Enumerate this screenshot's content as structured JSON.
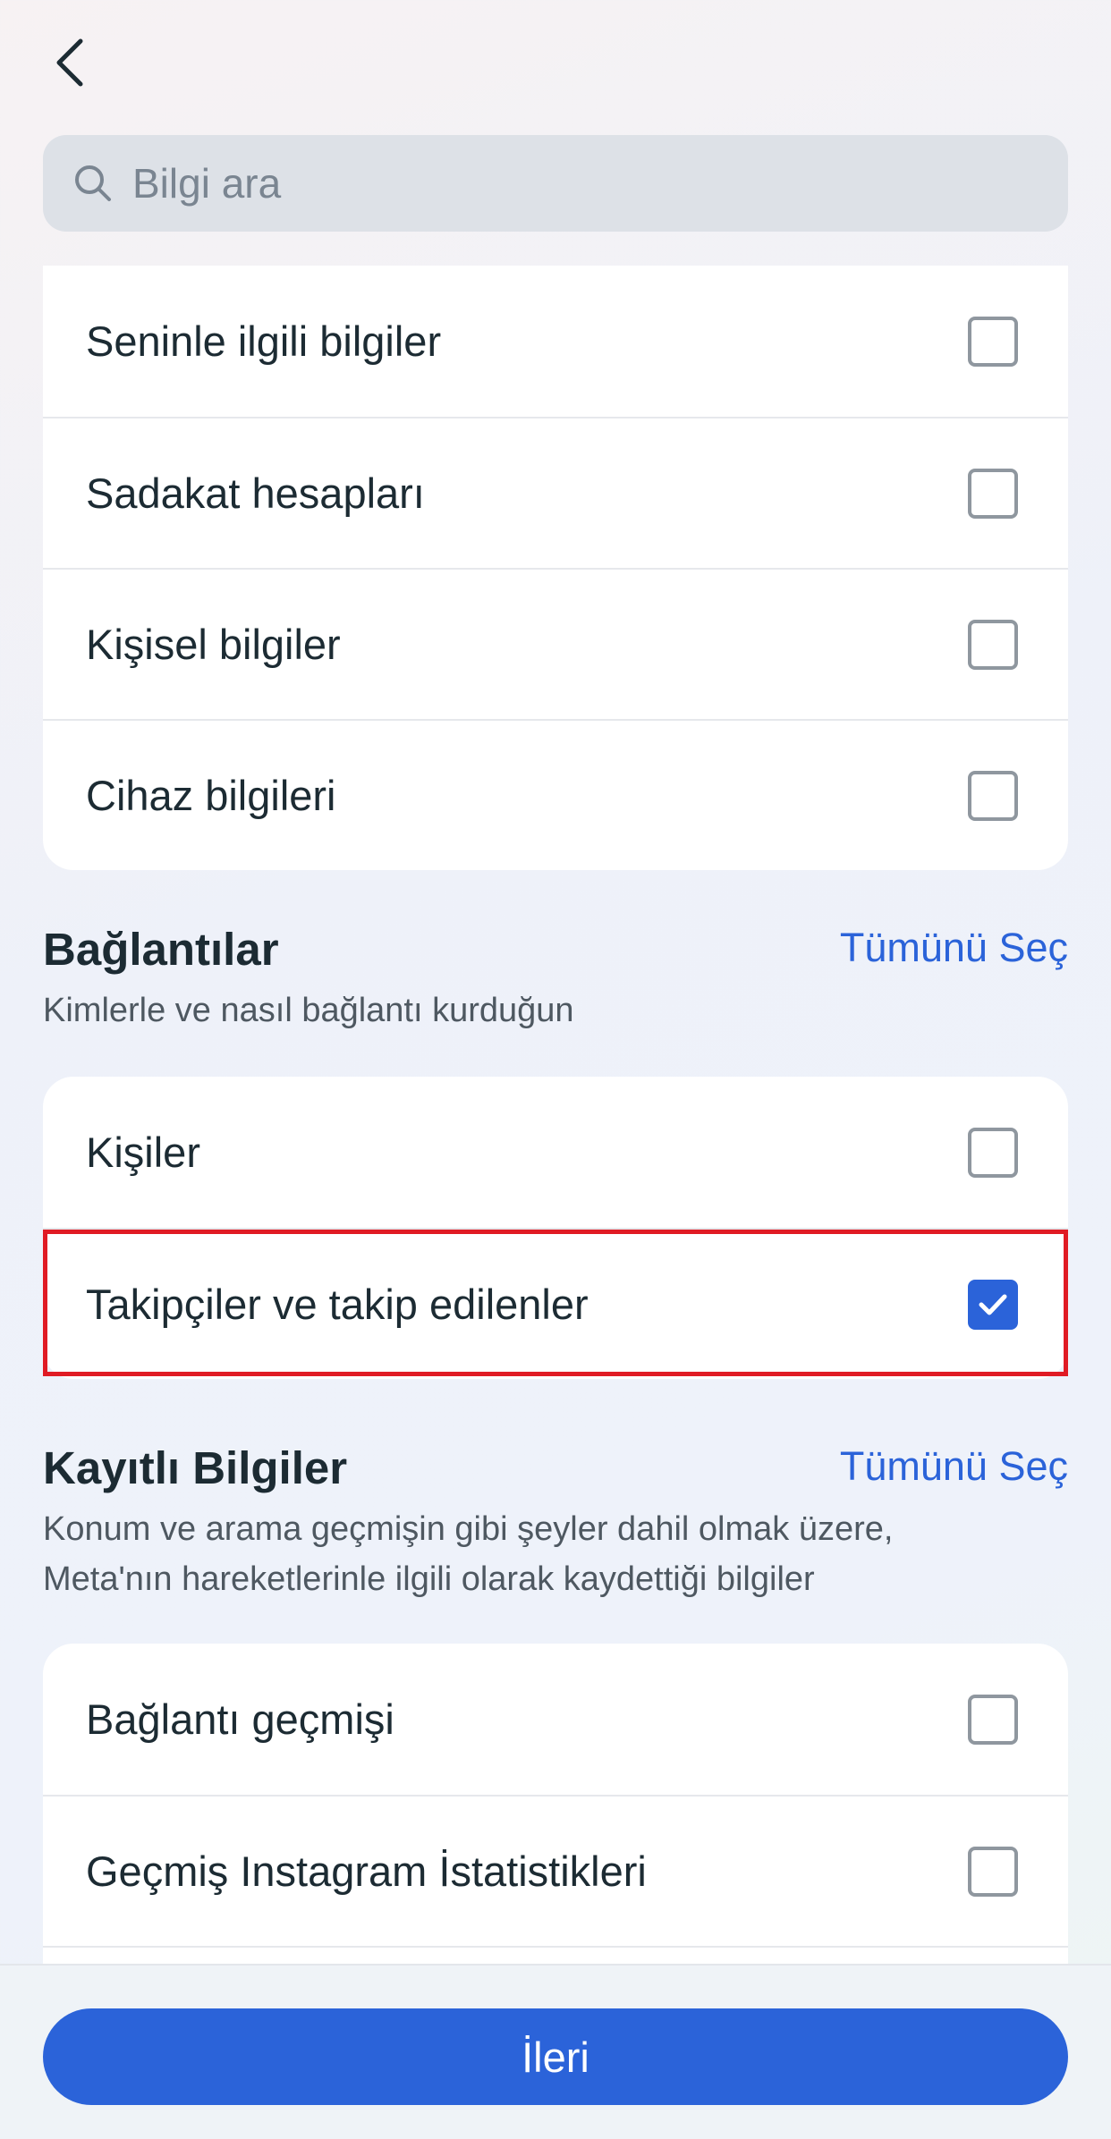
{
  "search": {
    "placeholder": "Bilgi ara"
  },
  "section_personal": {
    "items": [
      {
        "label": "Seninle ilgili bilgiler",
        "checked": false
      },
      {
        "label": "Sadakat hesapları",
        "checked": false
      },
      {
        "label": "Kişisel bilgiler",
        "checked": false
      },
      {
        "label": "Cihaz bilgileri",
        "checked": false
      }
    ]
  },
  "section_connections": {
    "title": "Bağlantılar",
    "select_all": "Tümünü Seç",
    "subtitle": "Kimlerle ve nasıl bağlantı kurduğun",
    "items": [
      {
        "label": "Kişiler",
        "checked": false
      },
      {
        "label": "Takipçiler ve takip edilenler",
        "checked": true
      }
    ]
  },
  "section_saved": {
    "title": "Kayıtlı Bilgiler",
    "select_all": "Tümünü Seç",
    "subtitle": "Konum ve arama geçmişin gibi şeyler dahil olmak üzere, Meta'nın hareketlerinle ilgili olarak kaydettiği bilgiler",
    "items": [
      {
        "label": "Bağlantı geçmişi",
        "checked": false
      },
      {
        "label": "Geçmiş Instagram İstatistikleri",
        "checked": false
      }
    ]
  },
  "footer": {
    "next_label": "İleri"
  },
  "colors": {
    "accent": "#2b63d9",
    "highlight": "#e01b24"
  }
}
